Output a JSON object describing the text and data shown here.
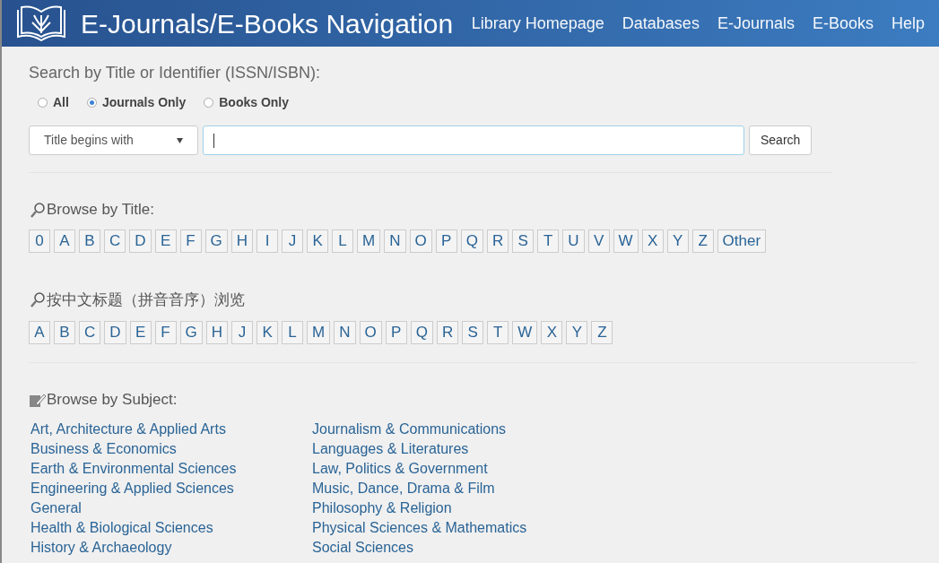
{
  "header": {
    "title": "E-Journals/E-Books Navigation",
    "nav": [
      "Library Homepage",
      "Databases",
      "E-Journals",
      "E-Books",
      "Help"
    ]
  },
  "search": {
    "heading": "Search by Title or Identifier (ISSN/ISBN):",
    "scope": [
      {
        "label": "All",
        "selected": false
      },
      {
        "label": "Journals Only",
        "selected": true
      },
      {
        "label": "Books Only",
        "selected": false
      }
    ],
    "mode": "Title begins with",
    "button": "Search"
  },
  "browse_title": {
    "heading": "Browse by Title:",
    "letters": [
      "0",
      "A",
      "B",
      "C",
      "D",
      "E",
      "F",
      "G",
      "H",
      "I",
      "J",
      "K",
      "L",
      "M",
      "N",
      "O",
      "P",
      "Q",
      "R",
      "S",
      "T",
      "U",
      "V",
      "W",
      "X",
      "Y",
      "Z",
      "Other"
    ]
  },
  "browse_pinyin": {
    "heading": "按中文标题（拼音音序）浏览",
    "letters": [
      "A",
      "B",
      "C",
      "D",
      "E",
      "F",
      "G",
      "H",
      "J",
      "K",
      "L",
      "M",
      "N",
      "O",
      "P",
      "Q",
      "R",
      "S",
      "T",
      "W",
      "X",
      "Y",
      "Z"
    ]
  },
  "browse_subject": {
    "heading": "Browse by Subject:",
    "columns": [
      [
        "Art, Architecture & Applied Arts",
        "Business & Economics",
        "Earth & Environmental Sciences",
        "Engineering & Applied Sciences",
        "General",
        "Health & Biological Sciences",
        "History & Archaeology"
      ],
      [
        "Journalism & Communications",
        "Languages & Literatures",
        "Law, Politics & Government",
        "Music, Dance, Drama & Film",
        "Philosophy & Religion",
        "Physical Sciences & Mathematics",
        "Social Sciences"
      ]
    ]
  }
}
